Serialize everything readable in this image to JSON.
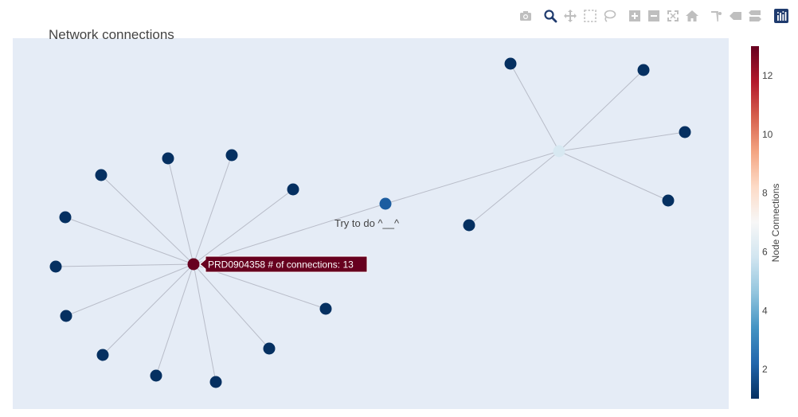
{
  "chart_data": {
    "type": "network",
    "title": "Network connections",
    "annotation": "Try to do ^__^",
    "nodes": [
      {
        "id": "hubA",
        "connections": 13,
        "label": "PRD0904358"
      },
      {
        "id": "a1",
        "connections": 1
      },
      {
        "id": "a2",
        "connections": 1
      },
      {
        "id": "a3",
        "connections": 1
      },
      {
        "id": "a4",
        "connections": 1
      },
      {
        "id": "a5",
        "connections": 1
      },
      {
        "id": "a6",
        "connections": 1
      },
      {
        "id": "a7",
        "connections": 1
      },
      {
        "id": "a8",
        "connections": 1
      },
      {
        "id": "a9",
        "connections": 1
      },
      {
        "id": "a10",
        "connections": 1
      },
      {
        "id": "a11",
        "connections": 1
      },
      {
        "id": "a12",
        "connections": 1
      },
      {
        "id": "bridge",
        "connections": 2
      },
      {
        "id": "hubB",
        "connections": 6
      },
      {
        "id": "b1",
        "connections": 1
      },
      {
        "id": "b2",
        "connections": 1
      },
      {
        "id": "b3",
        "connections": 1
      },
      {
        "id": "b4",
        "connections": 1
      },
      {
        "id": "b5",
        "connections": 1
      }
    ],
    "edges": [
      [
        "hubA",
        "a1"
      ],
      [
        "hubA",
        "a2"
      ],
      [
        "hubA",
        "a3"
      ],
      [
        "hubA",
        "a4"
      ],
      [
        "hubA",
        "a5"
      ],
      [
        "hubA",
        "a6"
      ],
      [
        "hubA",
        "a7"
      ],
      [
        "hubA",
        "a8"
      ],
      [
        "hubA",
        "a9"
      ],
      [
        "hubA",
        "a10"
      ],
      [
        "hubA",
        "a11"
      ],
      [
        "hubA",
        "a12"
      ],
      [
        "hubA",
        "bridge"
      ],
      [
        "bridge",
        "hubB"
      ],
      [
        "hubB",
        "b1"
      ],
      [
        "hubB",
        "b2"
      ],
      [
        "hubB",
        "b3"
      ],
      [
        "hubB",
        "b4"
      ],
      [
        "hubB",
        "b5"
      ]
    ],
    "hover": {
      "node": "hubA",
      "text": "PRD0904358 # of connections: 13"
    },
    "colorbar": {
      "title": "Node Connections",
      "range": [
        1,
        13
      ],
      "ticks": [
        2,
        4,
        6,
        8,
        10,
        12
      ],
      "colorscale": [
        [
          0.0,
          "#053061"
        ],
        [
          0.1,
          "#2166ac"
        ],
        [
          0.2,
          "#4393c3"
        ],
        [
          0.3,
          "#92c5de"
        ],
        [
          0.4,
          "#d1e5f0"
        ],
        [
          0.5,
          "#f7f7f7"
        ],
        [
          0.6,
          "#fddbc7"
        ],
        [
          0.7,
          "#f4a582"
        ],
        [
          0.8,
          "#d6604d"
        ],
        [
          0.9,
          "#b2182b"
        ],
        [
          1.0,
          "#67001f"
        ]
      ]
    },
    "colors": {
      "plot_bg": "#e5ecf6",
      "edge": "#b8bcc8",
      "text": "#444444",
      "modebar_icon": "#bfbfbf",
      "modebar_active": "#1f3b6e"
    }
  },
  "modebar": [
    {
      "icon": "camera-icon",
      "label": "Download plot as a png"
    },
    {
      "icon": "zoom-icon",
      "label": "Zoom",
      "active": true
    },
    {
      "icon": "pan-icon",
      "label": "Pan"
    },
    {
      "icon": "box-select-icon",
      "label": "Box Select"
    },
    {
      "icon": "lasso-icon",
      "label": "Lasso Select"
    },
    {
      "icon": "zoom-in-icon",
      "label": "Zoom in"
    },
    {
      "icon": "zoom-out-icon",
      "label": "Zoom out"
    },
    {
      "icon": "autoscale-icon",
      "label": "Autoscale"
    },
    {
      "icon": "home-icon",
      "label": "Reset axes"
    },
    {
      "icon": "spike-icon",
      "label": "Toggle Spike Lines"
    },
    {
      "icon": "hover-closest-icon",
      "label": "Show closest data on hover"
    },
    {
      "icon": "hover-compare-icon",
      "label": "Compare data on hover"
    },
    {
      "icon": "plotly-logo-icon",
      "label": "Produced with Plotly"
    }
  ]
}
